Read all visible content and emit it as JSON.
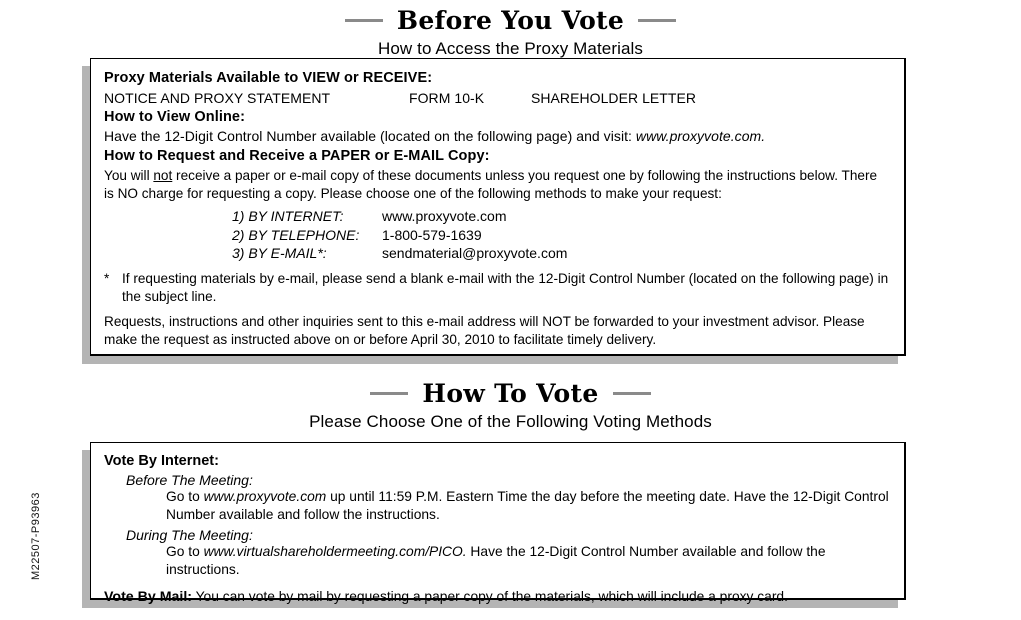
{
  "job_code": "M22507-P93963",
  "section1": {
    "title": "Before You Vote",
    "subtitle": "How to Access the Proxy Materials",
    "available_heading": "Proxy Materials Available to VIEW or RECEIVE:",
    "documents": [
      "NOTICE AND PROXY STATEMENT",
      "FORM 10-K",
      "SHAREHOLDER LETTER"
    ],
    "view_online_heading": "How to View Online:",
    "view_online_text_before": "Have the 12-Digit Control Number available (located on the following page) and visit: ",
    "view_online_url": "www.proxyvote.com.",
    "request_heading": "How to Request and Receive a PAPER or E-MAIL Copy:",
    "request_p1_a": "You will ",
    "request_p1_not": "not",
    "request_p1_b": " receive a paper or e-mail copy of these documents unless you request one by following the instructions below.  There is NO charge for requesting a copy.  Please choose one of the following methods to make your request:",
    "methods": [
      {
        "label": "1) BY INTERNET:",
        "value": "www.proxyvote.com"
      },
      {
        "label": "2) BY TELEPHONE:",
        "value": "1-800-579-1639"
      },
      {
        "label": "3) BY E-MAIL*:",
        "value": "sendmaterial@proxyvote.com"
      }
    ],
    "footnote_marker": "*",
    "footnote_text": "If requesting materials by e-mail, please send a blank e-mail with the 12-Digit Control Number (located on the following page) in the subject line.",
    "closing_text": "Requests, instructions and other inquiries sent to this e-mail address will NOT be forwarded to your investment advisor.  Please make the request as instructed above on or before April 30, 2010 to facilitate timely delivery."
  },
  "section2": {
    "title": "How To Vote",
    "subtitle": "Please Choose One of the Following Voting Methods",
    "internet_heading": "Vote By Internet:",
    "before_meeting_label": "Before The Meeting:",
    "before_meeting_a": "Go to ",
    "before_meeting_url": "www.proxyvote.com",
    "before_meeting_b": " up until 11:59 P.M. Eastern Time the day before the meeting date.  Have the 12-Digit Control Number available and follow the instructions.",
    "during_meeting_label": "During The Meeting:",
    "during_meeting_a": "Go to ",
    "during_meeting_url": "www.virtualshareholdermeeting.com/PICO.",
    "during_meeting_b": "  Have the 12-Digit Control Number available and follow the instructions.",
    "mail_label": "Vote By Mail:",
    "mail_text": " You can vote by mail by requesting a paper copy of the materials, which will include a proxy card."
  },
  "colors": {
    "shadow": "#b4b4b4",
    "dash": "#8a8a8a",
    "border": "#000000"
  }
}
